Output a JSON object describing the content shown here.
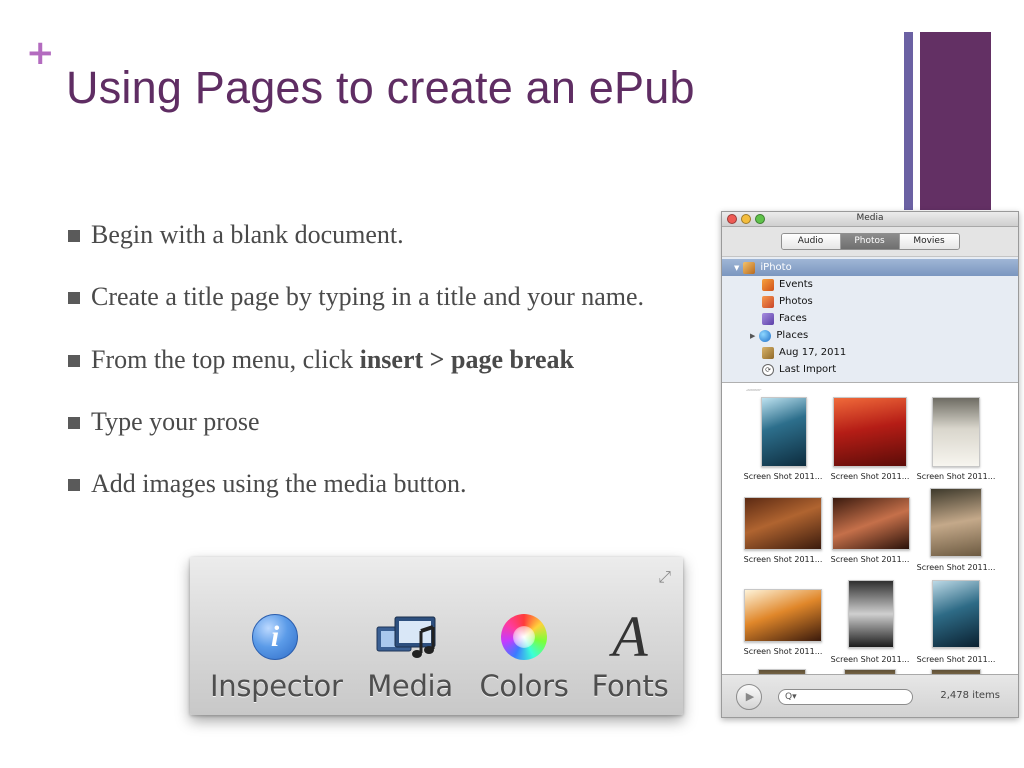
{
  "slide": {
    "plus": "+",
    "title": "Using Pages to create an ePub",
    "accent_colors": {
      "title": "#5f2d63",
      "plus": "#b36bbf",
      "bar_thin": "#6b61a3",
      "bar_thick": "#633064"
    }
  },
  "bullets": [
    {
      "text": "Begin with a blank document."
    },
    {
      "text": "Create a title page by typing in a title and your name."
    },
    {
      "prefix": "From the top menu, click ",
      "bold": "insert > page break"
    },
    {
      "text": "Type your prose"
    },
    {
      "text": "Add images using the media button."
    }
  ],
  "toolbar": {
    "items": [
      {
        "label": "Inspector",
        "icon": "info-icon"
      },
      {
        "label": "Media",
        "icon": "media-icon"
      },
      {
        "label": "Colors",
        "icon": "color-wheel-icon"
      },
      {
        "label": "Fonts",
        "icon": "font-icon",
        "glyph": "A"
      }
    ]
  },
  "media_window": {
    "title": "Media",
    "tabs": [
      {
        "label": "Audio",
        "active": false
      },
      {
        "label": "Photos",
        "active": true
      },
      {
        "label": "Movies",
        "active": false
      }
    ],
    "sources": {
      "root": "iPhoto",
      "children": [
        "Events",
        "Photos",
        "Faces",
        "Places",
        "Aug 17, 2011",
        "Last Import"
      ]
    },
    "thumbnails": [
      "Screen Shot 2011...",
      "Screen Shot 2011...",
      "Screen Shot 2011...",
      "Screen Shot 2011...",
      "Screen Shot 2011...",
      "Screen Shot 2011...",
      "Screen Shot 2011...",
      "Screen Shot 2011...",
      "Screen Shot 2011..."
    ],
    "search_placeholder": "Q▾",
    "item_count": "2,478 items"
  }
}
